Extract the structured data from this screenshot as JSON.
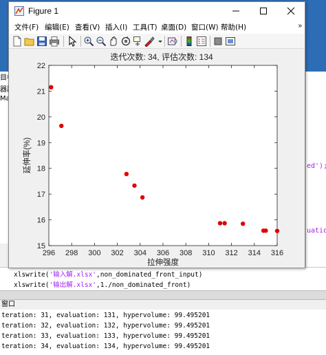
{
  "window": {
    "title": "Figure 1",
    "controls": {
      "minimize": "—",
      "maximize": "☐",
      "close": "✕"
    }
  },
  "menu": {
    "items": [
      "文件(F)",
      "编辑(E)",
      "查看(V)",
      "插入(I)",
      "工具(T)",
      "桌面(D)",
      "窗口(W)",
      "帮助(H)"
    ],
    "overflow": "»"
  },
  "toolbar": {
    "icons": [
      "new-figure-icon",
      "open-file-icon",
      "save-icon",
      "print-icon",
      "pointer-icon",
      "zoom-in-icon",
      "zoom-out-icon",
      "pan-icon",
      "rotate-3d-icon",
      "data-cursor-icon",
      "brush-icon",
      "link-plot-icon",
      "colorbar-icon",
      "legend-icon",
      "hide-plot-tools-icon",
      "show-plot-tools-icon"
    ]
  },
  "chart_data": {
    "type": "scatter",
    "title": "迭代次数: 34, 评估次数: 134",
    "xlabel": "拉伸强度",
    "ylabel": "延伸率(%)",
    "xlim": [
      296,
      316
    ],
    "ylim": [
      15,
      22
    ],
    "xticks": [
      296,
      298,
      300,
      302,
      304,
      306,
      308,
      310,
      312,
      314,
      316
    ],
    "yticks": [
      15,
      16,
      17,
      18,
      19,
      20,
      21,
      22
    ],
    "grid": false,
    "marker_color": "#e00000",
    "points": [
      {
        "x": 296.2,
        "y": 21.15
      },
      {
        "x": 297.1,
        "y": 19.65
      },
      {
        "x": 302.8,
        "y": 17.78
      },
      {
        "x": 303.5,
        "y": 17.33
      },
      {
        "x": 304.2,
        "y": 16.87
      },
      {
        "x": 311.0,
        "y": 15.87
      },
      {
        "x": 311.4,
        "y": 15.87
      },
      {
        "x": 313.0,
        "y": 15.85
      },
      {
        "x": 314.8,
        "y": 15.58
      },
      {
        "x": 315.0,
        "y": 15.58
      },
      {
        "x": 316.0,
        "y": 15.57
      }
    ]
  },
  "background": {
    "left_labels": [
      "目标",
      "器器",
      "Mai"
    ],
    "right_code": [
      "ed');",
      "uatio"
    ],
    "editor_lines": [
      {
        "cmd": "xlswrite(",
        "str": "'输入解.xlsx'",
        "rest": ",non_dominated_front_input)"
      },
      {
        "cmd": "xlswrite(",
        "str": "'输出解.xlsx'",
        "rest": ",1./non_dominated_front)"
      }
    ],
    "command_window_title": "窗口",
    "command_lines": [
      "teration: 31, evaluation: 131, hypervolume: 99.495201",
      "teration: 32, evaluation: 132, hypervolume: 99.495201",
      "teration: 33, evaluation: 133, hypervolume: 99.495201",
      "teration: 34, evaluation: 134, hypervolume: 99.495201"
    ]
  }
}
